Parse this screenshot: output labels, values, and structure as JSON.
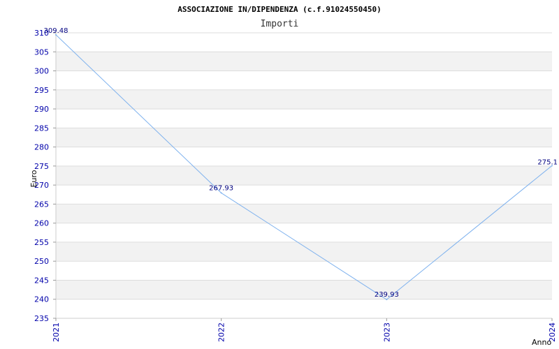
{
  "chart_data": {
    "type": "line",
    "title": "ASSOCIAZIONE IN/DIPENDENZA (c.f.91024550450)",
    "subtitle": "Importi",
    "xlabel": "Anno",
    "ylabel": "Euro",
    "x": [
      "2021",
      "2022",
      "2023",
      "2024"
    ],
    "values": [
      309.48,
      267.93,
      239.93,
      275.1
    ],
    "data_labels": [
      "309.48",
      "267.93",
      "239.93",
      "275.1"
    ],
    "ylim": [
      235,
      310
    ],
    "y_ticks": [
      235,
      240,
      245,
      250,
      255,
      260,
      265,
      270,
      275,
      280,
      285,
      290,
      295,
      300,
      305,
      310
    ],
    "grid": "horizontal alternating bands",
    "line_color": "#7fb2ee",
    "band_color": "#f2f2f2",
    "tick_color": "#0000aa",
    "label_color": "#000080"
  }
}
